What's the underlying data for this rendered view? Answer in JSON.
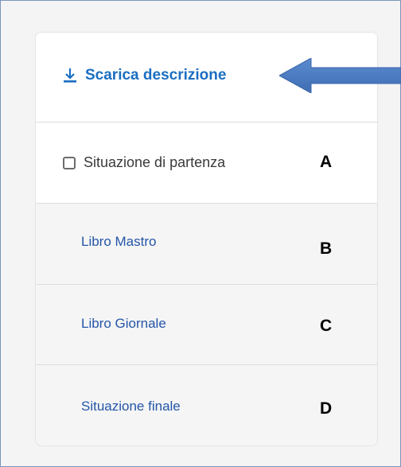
{
  "download": {
    "label": "Scarica descrizione",
    "icon": "download-icon"
  },
  "items": [
    {
      "label": "Situazione di partenza",
      "type": "checkbox",
      "checked": false
    },
    {
      "label": "Libro Mastro",
      "type": "link"
    },
    {
      "label": "Libro Giornale",
      "type": "link"
    },
    {
      "label": "Situazione finale",
      "type": "link"
    }
  ],
  "annotations": {
    "a": "A",
    "b": "B",
    "c": "C",
    "d": "D"
  },
  "colors": {
    "accent": "#1b6ec2",
    "link": "#2456a6",
    "arrow": "#4a78bf"
  }
}
